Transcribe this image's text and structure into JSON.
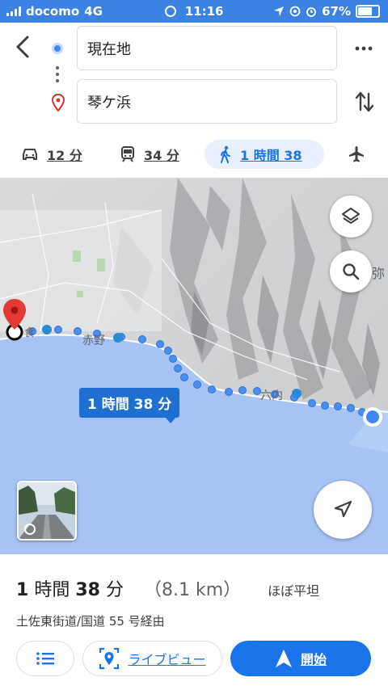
{
  "status": {
    "carrier": "docomo",
    "network": "4G",
    "time": "11:16",
    "battery": "67%"
  },
  "route": {
    "origin": "現在地",
    "destination": "琴ケ浜",
    "back_icon": "chevron-left-icon",
    "more_icon": "more-horiz-icon",
    "swap_icon": "swap-vert-icon"
  },
  "modes": [
    {
      "icon": "car-icon",
      "label": "12 分"
    },
    {
      "icon": "train-icon",
      "label": "34 分"
    },
    {
      "icon": "walk-icon",
      "label": "1 時間 38",
      "active": true
    },
    {
      "icon": "flight-icon",
      "label": ""
    }
  ],
  "map": {
    "duration_label": "1 時間 38 分",
    "place_labels": [
      "赤野",
      "六内",
      "弥",
      "食"
    ],
    "buttons": [
      "layers-icon",
      "search-icon",
      "my-location-icon"
    ]
  },
  "summary": {
    "duration_num1": "1",
    "duration_unit1": "時間",
    "duration_num2": "38",
    "duration_unit2": "分",
    "distance": "（8.1 km）",
    "terrain": "ほぼ平坦",
    "via": "土佐東街道/国道 55 号経由"
  },
  "actions": {
    "steps_icon": "list-icon",
    "live_view": "ライブビュー",
    "start": "開始"
  },
  "colors": {
    "accent": "#1a73e8",
    "status_bar": "#3b82e4",
    "sea": "#a6c3f4",
    "route_dot": "#4a8ff0",
    "pin": "#e53935"
  }
}
